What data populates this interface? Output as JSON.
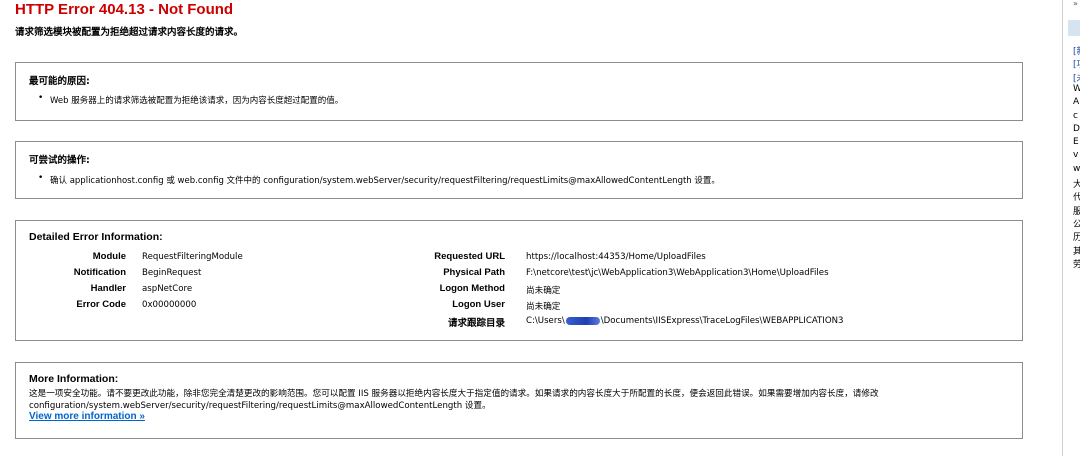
{
  "header": {
    "title": "HTTP Error 404.13 - Not Found",
    "subtitle": "请求筛选模块被配置为拒绝超过请求内容长度的请求。"
  },
  "causes": {
    "heading": "最可能的原因:",
    "item": "Web 服务器上的请求筛选被配置为拒绝该请求，因为内容长度超过配置的值。"
  },
  "actions": {
    "heading": "可尝试的操作:",
    "item": "确认 applicationhost.config 或 web.config 文件中的 configuration/system.webServer/security/requestFiltering/requestLimits@maxAllowedContentLength 设置。"
  },
  "details": {
    "heading": "Detailed Error Information:",
    "left": [
      {
        "label": "Module",
        "value": "RequestFilteringModule"
      },
      {
        "label": "Notification",
        "value": "BeginRequest"
      },
      {
        "label": "Handler",
        "value": "aspNetCore"
      },
      {
        "label": "Error Code",
        "value": "0x00000000"
      }
    ],
    "right": [
      {
        "label": "Requested URL",
        "value": "https://localhost:44353/Home/UploadFiles"
      },
      {
        "label": "Physical Path",
        "value": "F:\\netcore\\test\\jc\\WebApplication3\\WebApplication3\\Home\\UploadFiles"
      },
      {
        "label": "Logon Method",
        "value": "尚未确定"
      },
      {
        "label": "Logon User",
        "value": "尚未确定"
      },
      {
        "label": "请求跟踪目录",
        "value_prefix": "C:\\Users\\",
        "value_suffix": "\\Documents\\IISExpress\\TraceLogFiles\\WEBAPPLICATION3"
      }
    ]
  },
  "more": {
    "heading": "More Information:",
    "text": "这是一项安全功能。请不要更改此功能，除非您完全清楚更改的影响范围。您可以配置 IIS 服务器以拒绝内容长度大于指定值的请求。如果请求的内容长度大于所配置的长度，便会返回此错误。如果需要增加内容长度，请修改 configuration/system.webServer/security/requestFiltering/requestLimits@maxAllowedContentLength 设置。",
    "link": "View more information »"
  },
  "side_panel": {
    "chevron": "»",
    "lines": [
      "[新",
      "[项",
      "[未",
      "W",
      "A",
      "c",
      "D",
      "E",
      "v",
      "w",
      "大",
      "代",
      "服",
      "公",
      "历",
      "其",
      "劳"
    ]
  }
}
